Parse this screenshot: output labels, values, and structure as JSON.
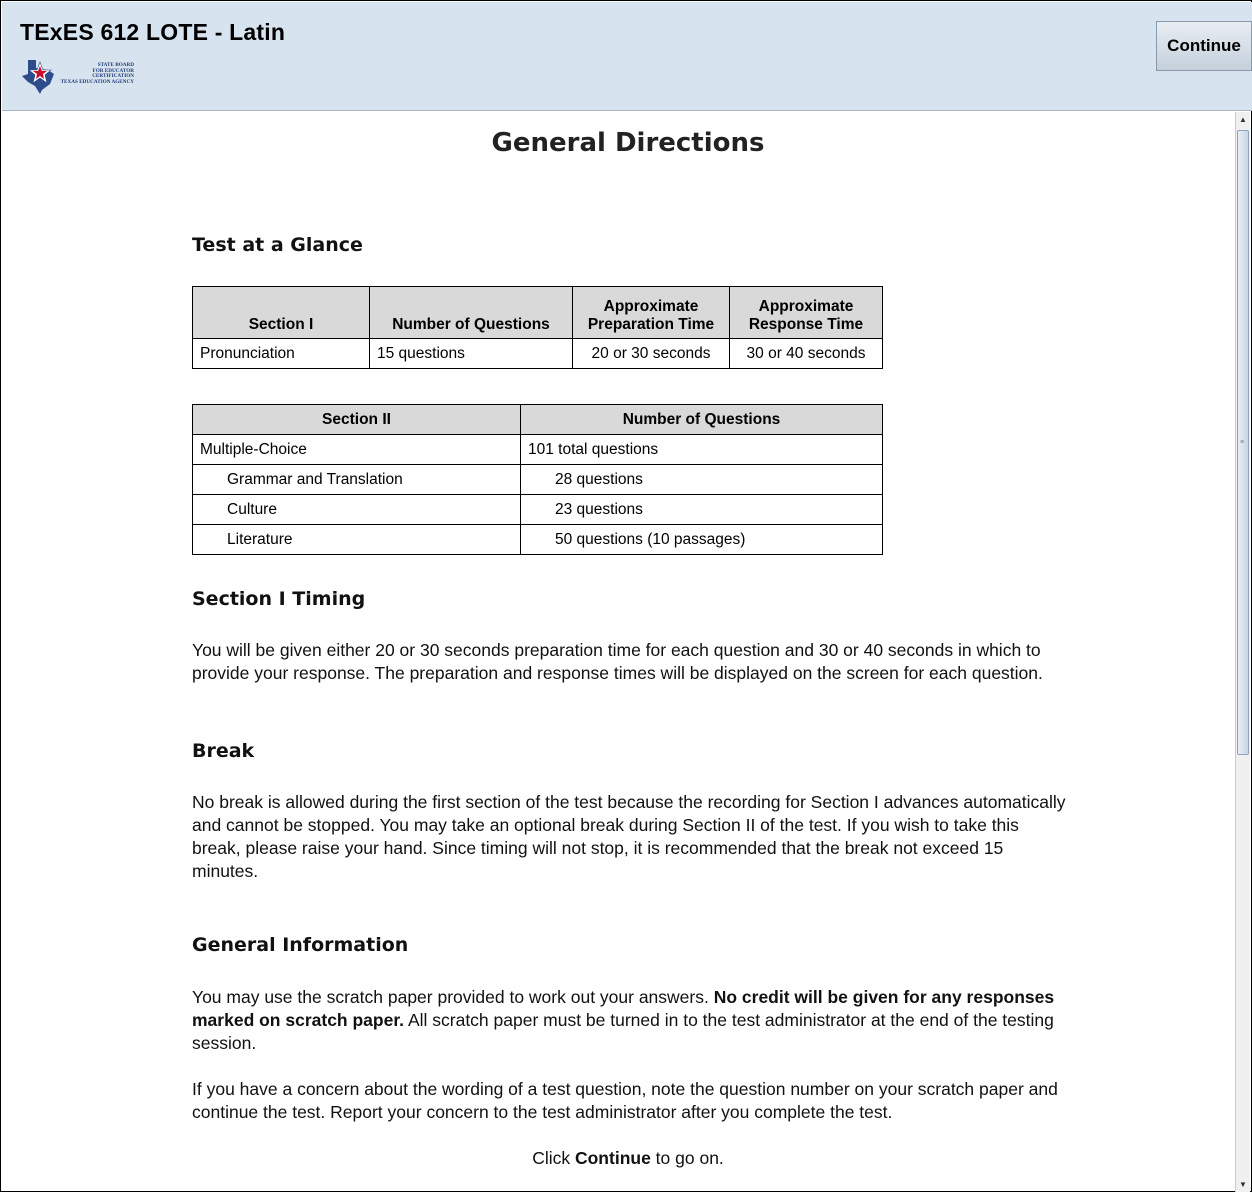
{
  "header": {
    "title": "TExES 612 LOTE - Latin",
    "logo_text": [
      "STATE BOARD",
      "FOR EDUCATOR",
      "CERTIFICATION",
      "TEXAS EDUCATION AGENCY"
    ],
    "continue_label": "Continue"
  },
  "page": {
    "title": "General Directions"
  },
  "glance": {
    "heading": "Test at a Glance",
    "table1": {
      "headers": [
        "Section I",
        "Number of Questions",
        "Approximate Preparation Time",
        "Approximate Response Time"
      ],
      "row": [
        "Pronunciation",
        "15 questions",
        "20 or 30 seconds",
        "30 or 40 seconds"
      ]
    },
    "table2": {
      "headers": [
        "Section II",
        "Number of Questions"
      ],
      "rows": [
        [
          "Multiple-Choice",
          "101 total questions"
        ],
        [
          "Grammar and Translation",
          "28 questions"
        ],
        [
          "Culture",
          "23 questions"
        ],
        [
          "Literature",
          "50 questions (10 passages)"
        ]
      ]
    }
  },
  "timing": {
    "heading": "Section I Timing",
    "text": "You will be given either 20 or 30 seconds preparation time for each question and 30 or 40 seconds in which to provide your response. The preparation and response times will be displayed on the screen for each question."
  },
  "break": {
    "heading": "Break",
    "text": "No break is allowed during the first section of the test because the recording for Section I advances automatically and cannot be stopped. You may take an optional break during Section II of the test.  If you wish to take this break, please raise your hand. Since timing will not stop, it is recommended that the break not exceed 15 minutes."
  },
  "info": {
    "heading": "General Information",
    "p1_start": "You may use the scratch paper provided to work out your answers. ",
    "p1_bold": "No credit will be given for any responses marked on scratch paper.",
    "p1_end": " All scratch paper must be turned in to the test administrator at the end of the testing session.",
    "p2": "If you have a concern about the wording of a test question, note the question number on your scratch paper and continue the test. Report your concern to the test administrator after you complete the test."
  },
  "footer": {
    "prefix": "Click ",
    "bold": "Continue",
    "suffix": " to go on."
  }
}
